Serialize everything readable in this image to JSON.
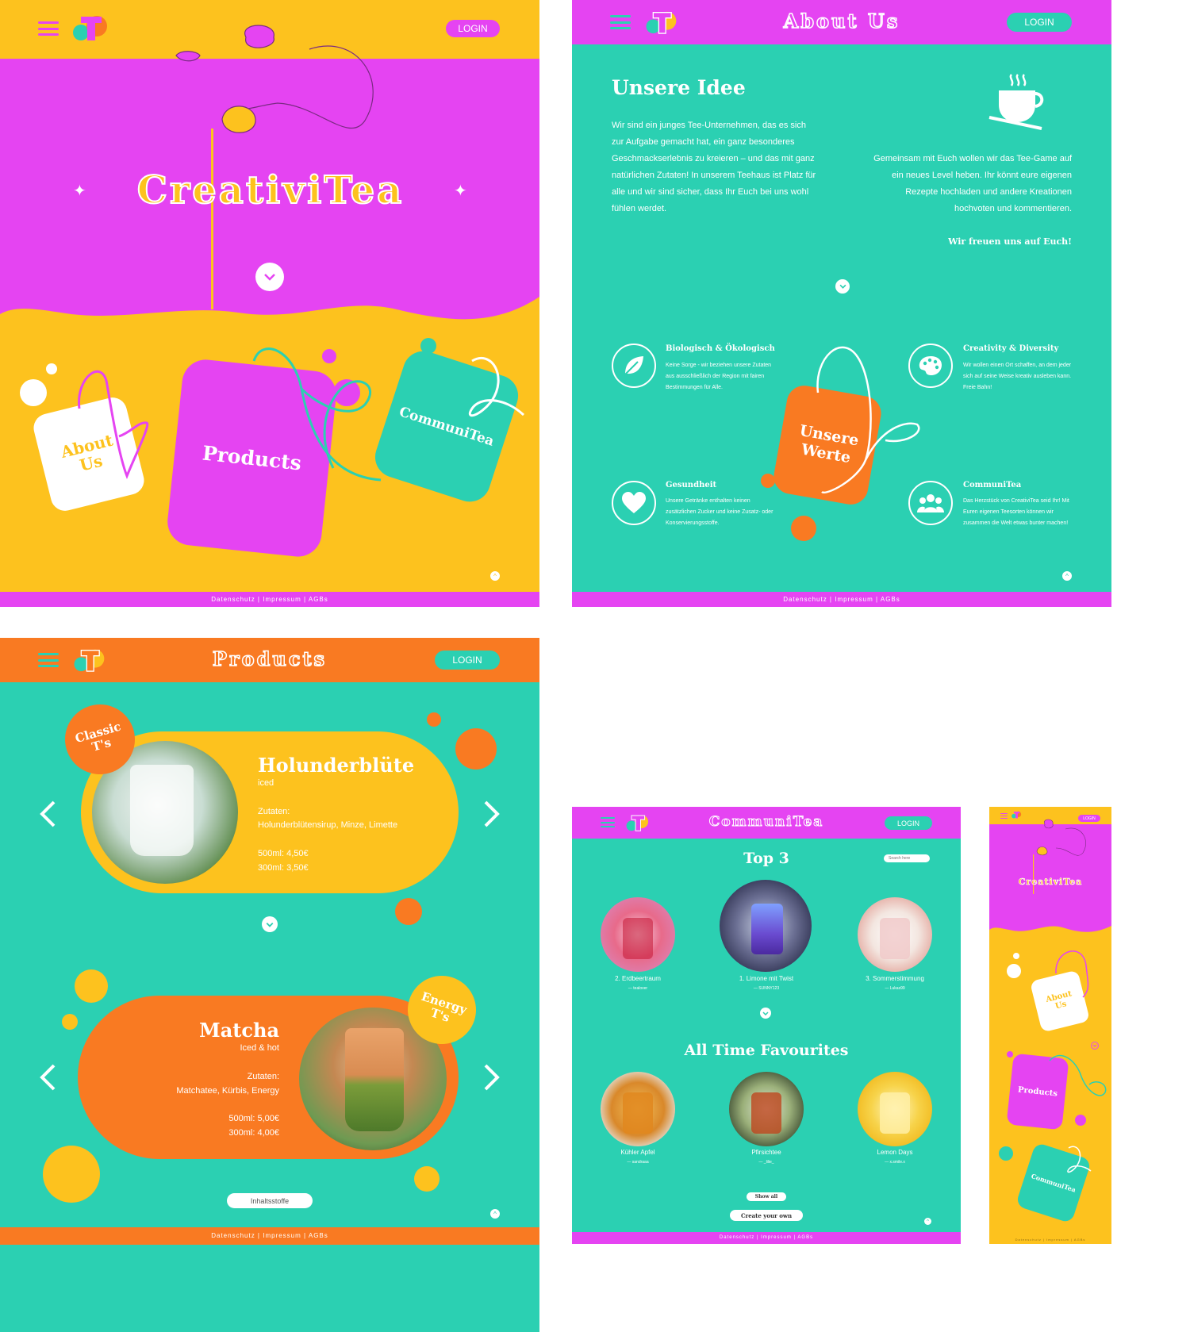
{
  "colors": {
    "magenta": "#e544f2",
    "yellow": "#fdc21e",
    "teal": "#2bd0b2",
    "orange": "#f97a22",
    "white": "#ffffff"
  },
  "common": {
    "login": "LOGIN",
    "footer": "Datenschutz | Impressum | AGBs"
  },
  "home": {
    "title": "CreativiTea",
    "tags": {
      "about": "About Us",
      "products": "Products",
      "community": "CommuniTea"
    }
  },
  "about": {
    "header_title": "About Us",
    "idea_title": "Unsere Idee",
    "idea_left": "Wir sind ein junges Tee-Unternehmen, das es sich zur Aufgabe gemacht hat, ein ganz besonderes Geschmackserlebnis zu kreieren – und das mit ganz natürlichen Zutaten! In unserem Teehaus ist Platz für alle und wir sind sicher, dass Ihr Euch bei uns wohl fühlen werdet.",
    "idea_right": "Gemeinsam mit Euch wollen wir das Tee-Game auf ein neues Level heben. Ihr könnt eure eigenen Rezepte hochladen und andere Kreationen hochvoten und kommentieren.",
    "idea_sign": "Wir freuen uns auf Euch!",
    "values_tag": "Unsere Werte",
    "values": [
      {
        "title": "Biologisch & Ökologisch",
        "text": "Keine Sorge - wir beziehen unsere Zutaten aus ausschließlich der Region mit fairen Bestimmungen für Alle.",
        "icon": "leaf-icon"
      },
      {
        "title": "Creativity & Diversity",
        "text": "Wir wollen einen Ort schaffen, an dem jeder sich auf seine Weise kreativ ausleben kann. Freie Bahn!",
        "icon": "palette-icon"
      },
      {
        "title": "Gesundheit",
        "text": "Unsere Getränke enthalten keinen zusätzlichen Zucker und keine Zusatz- oder Konservierungsstoffe.",
        "icon": "heart-icon"
      },
      {
        "title": "CommuniTea",
        "text": "Das Herzstück von CreativiTea seid Ihr! Mit Euren eigenen Teesorten können wir zusammen die Welt etwas bunter machen!",
        "icon": "group-icon"
      }
    ]
  },
  "products": {
    "header_title": "Products",
    "items": [
      {
        "badge": "Classic T's",
        "name": "Holunderblüte",
        "variant": "iced",
        "ingredients_label": "Zutaten:",
        "ingredients": "Holunderblütensirup, Minze, Limette",
        "price1": "500ml: 4,50€",
        "price2": "300ml: 3,50€"
      },
      {
        "badge": "Energy T's",
        "name": "Matcha",
        "variant": "Iced & hot",
        "ingredients_label": "Zutaten:",
        "ingredients": "Matchatee, Kürbis, Energy",
        "price1": "500ml: 5,00€",
        "price2": "300ml: 4,00€"
      }
    ],
    "button": "Inhaltsstoffe"
  },
  "community": {
    "header_title": "CommuniTea",
    "top_title": "Top 3",
    "search_placeholder": "Search here",
    "top": [
      {
        "name": "2. Erdbeertraum",
        "user": "— tealover"
      },
      {
        "name": "1. Limone mit Twist",
        "user": "— SUNNY123"
      },
      {
        "name": "3. Sommerstimmung",
        "user": "— Lukas99"
      }
    ],
    "fav_title": "All Time Favourites",
    "favs": [
      {
        "name": "Kühler Apfel",
        "user": "— sandraaa"
      },
      {
        "name": "Pfirsichtee",
        "user": "— _lilie_"
      },
      {
        "name": "Lemon Days",
        "user": "— x.smile.x"
      }
    ],
    "show_all": "Show all",
    "create": "Create your own"
  },
  "mobile": {
    "login": "LOGIN",
    "title": "CreativiTea",
    "tags": {
      "about": "About Us",
      "products": "Products",
      "community": "CommuniTea"
    },
    "footer": "Datenschutz | Impressum | AGBs"
  }
}
